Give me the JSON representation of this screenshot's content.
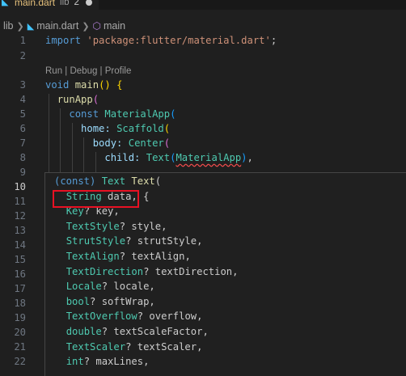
{
  "tab": {
    "filename": "main.dart",
    "dir_hint": "lib",
    "problems": "2",
    "dart_icon": "dart-file-icon"
  },
  "breadcrumb": {
    "folder": "lib",
    "file": "main.dart",
    "symbol": "main",
    "symbol_icon": "method-cube-icon"
  },
  "codelens": "Run | Debug | Profile",
  "gutter": {
    "line_numbers": [
      "1",
      "2",
      "3",
      "4",
      "5",
      "6",
      "7",
      "8",
      "9",
      "10",
      "11",
      "12",
      "13",
      "14",
      "15",
      "16",
      "17",
      "18",
      "19",
      "20",
      "21",
      "22"
    ],
    "active_line": "10"
  },
  "code": {
    "l1_kw": "import",
    "l1_str": "'package:flutter/material.dart'",
    "l1_end": ";",
    "l3_type": "void",
    "l3_fn": "main",
    "l3_paren": "()",
    "l3_brace": "{",
    "l4_fn": "runApp",
    "l4_paren": "(",
    "l5_kw": "const",
    "l5_cls": "MaterialApp",
    "l5_paren": "(",
    "l6_prm": "home:",
    "l6_cls": "Scaffold",
    "l6_paren": "(",
    "l7_prm": "body:",
    "l7_cls": "Center",
    "l7_paren": "(",
    "l8_prm": "child:",
    "l8_cls": "Text",
    "l8_open": "(",
    "l8_arg": "MaterialApp",
    "l8_close": ")",
    "l8_end": ","
  },
  "hover": {
    "lines": [
      [
        "(const) ",
        "Text",
        " ",
        "Text",
        "("
      ],
      [
        "String",
        " data, {"
      ],
      [
        "Key",
        "? key,"
      ],
      [
        "TextStyle",
        "? style,"
      ],
      [
        "StrutStyle",
        "? strutStyle,"
      ],
      [
        "TextAlign",
        "? textAlign,"
      ],
      [
        "TextDirection",
        "? textDirection,"
      ],
      [
        "Locale",
        "? locale,"
      ],
      [
        "bool",
        "? softWrap,"
      ],
      [
        "TextOverflow",
        "? overflow,"
      ],
      [
        "double",
        "? textScaleFactor,"
      ],
      [
        "TextScaler",
        "? textScaler,"
      ],
      [
        "int",
        "? maxLines,"
      ]
    ]
  },
  "colors": {
    "editor_bg": "#1f1f1f",
    "highlight_box": "#e81123",
    "type_color": "#4ec9b0",
    "keyword_color": "#569cd6",
    "string_color": "#ce9178"
  }
}
